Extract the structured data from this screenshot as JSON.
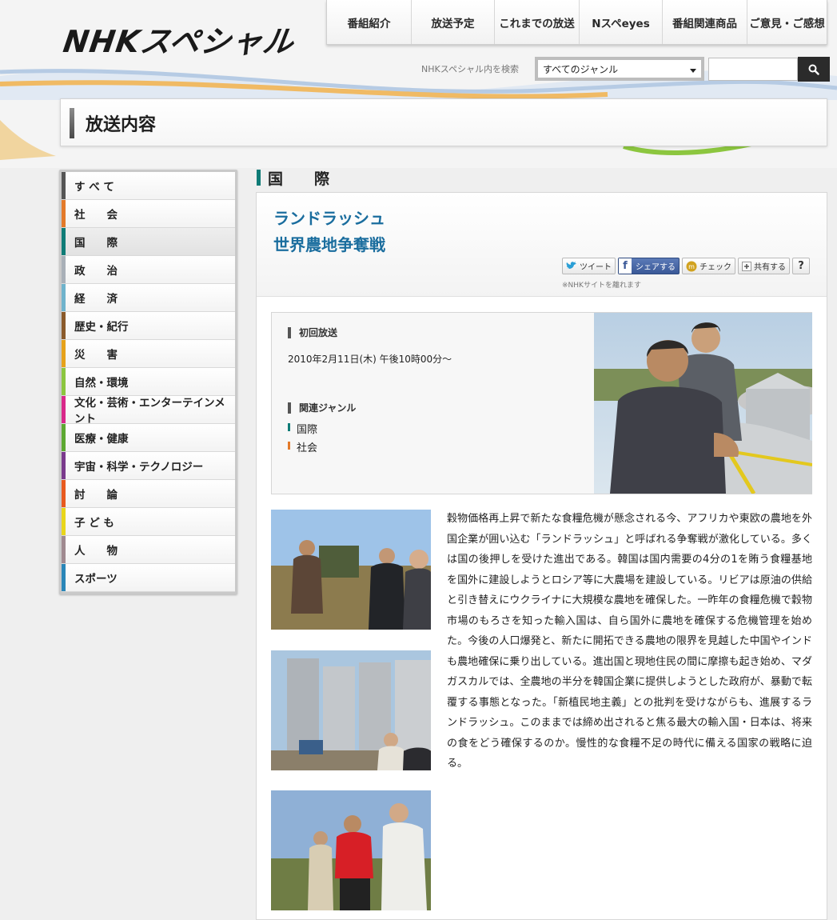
{
  "site": {
    "logo_text": "NHKスペシャル"
  },
  "topnav": {
    "items": [
      {
        "label": "番組紹介"
      },
      {
        "label": "放送予定"
      },
      {
        "label": "これまでの放送"
      },
      {
        "label": "Nスペeyes"
      },
      {
        "label": "番組関連商品"
      },
      {
        "label": "ご意見・ご感想"
      }
    ]
  },
  "search": {
    "label": "NHKスペシャル内を検索",
    "genre_selected": "すべてのジャンル",
    "input_value": ""
  },
  "page": {
    "title": "放送内容"
  },
  "sidebar": {
    "items": [
      {
        "label": "す べ て",
        "color": "#555555"
      },
      {
        "label": "社　　会",
        "color": "#e37a2a"
      },
      {
        "label": "国　　際",
        "color": "#0f7c77"
      },
      {
        "label": "政　　治",
        "color": "#a9b0b8"
      },
      {
        "label": "経　　済",
        "color": "#6fb3cc"
      },
      {
        "label": "歴史・紀行",
        "color": "#8a5a2a"
      },
      {
        "label": "災　　害",
        "color": "#e6a21a"
      },
      {
        "label": "自然・環境",
        "color": "#8cc63f"
      },
      {
        "label": "文化・芸術・エンターテインメント",
        "color": "#d9288a"
      },
      {
        "label": "医療・健康",
        "color": "#5da832"
      },
      {
        "label": "宇宙・科学・テクノロジー",
        "color": "#7a3a8c"
      },
      {
        "label": "討　　論",
        "color": "#e85a1f"
      },
      {
        "label": "子 ど も",
        "color": "#e9d61b"
      },
      {
        "label": "人　　物",
        "color": "#a08a90"
      },
      {
        "label": "スポーツ",
        "color": "#2a86b8"
      }
    ],
    "active_index": 2
  },
  "section": {
    "label": "国　際"
  },
  "program": {
    "title_line1": "ランドラッシュ",
    "title_line2": "世界農地争奪戦",
    "social": {
      "tweet": "ツイート",
      "share": "シェアする",
      "check": "チェック",
      "plus": "共有する",
      "help": "?"
    },
    "leave_note": "※NHKサイトを離れます",
    "first_air_label": "初回放送",
    "first_air_date": "2010年2月11日(木) 午後10時00分～",
    "genre_label": "関連ジャンル",
    "genres": [
      {
        "label": "国際",
        "color": "#0f7c77"
      },
      {
        "label": "社会",
        "color": "#e37a2a"
      }
    ],
    "description": "穀物価格再上昇で新たな食糧危機が懸念される今、アフリカや東欧の農地を外国企業が囲い込む「ランドラッシュ」と呼ばれる争奪戦が激化している。多くは国の後押しを受けた進出である。韓国は国内需要の4分の1を賄う食糧基地を国外に建設しようとロシア等に大農場を建設している。リビアは原油の供給と引き替えにウクライナに大規模な農地を確保した。一昨年の食糧危機で穀物市場のもろさを知った輸入国は、自ら国外に農地を確保する危機管理を始めた。今後の人口爆発と、新たに開拓できる農地の限界を見越した中国やインドも農地確保に乗り出している。進出国と現地住民の間に摩擦も起き始め、マダガスカルでは、全農地の半分を韓国企業に提供しようとした政府が、暴動で転覆する事態となった。「新植民地主義」との批判を受けながらも、進展するランドラッシュ。このままでは締め出されると焦る最大の輸入国・日本は、将来の食をどう確保するのか。慢性的な食糧不足の時代に備える国家の戦略に迫る。"
  }
}
